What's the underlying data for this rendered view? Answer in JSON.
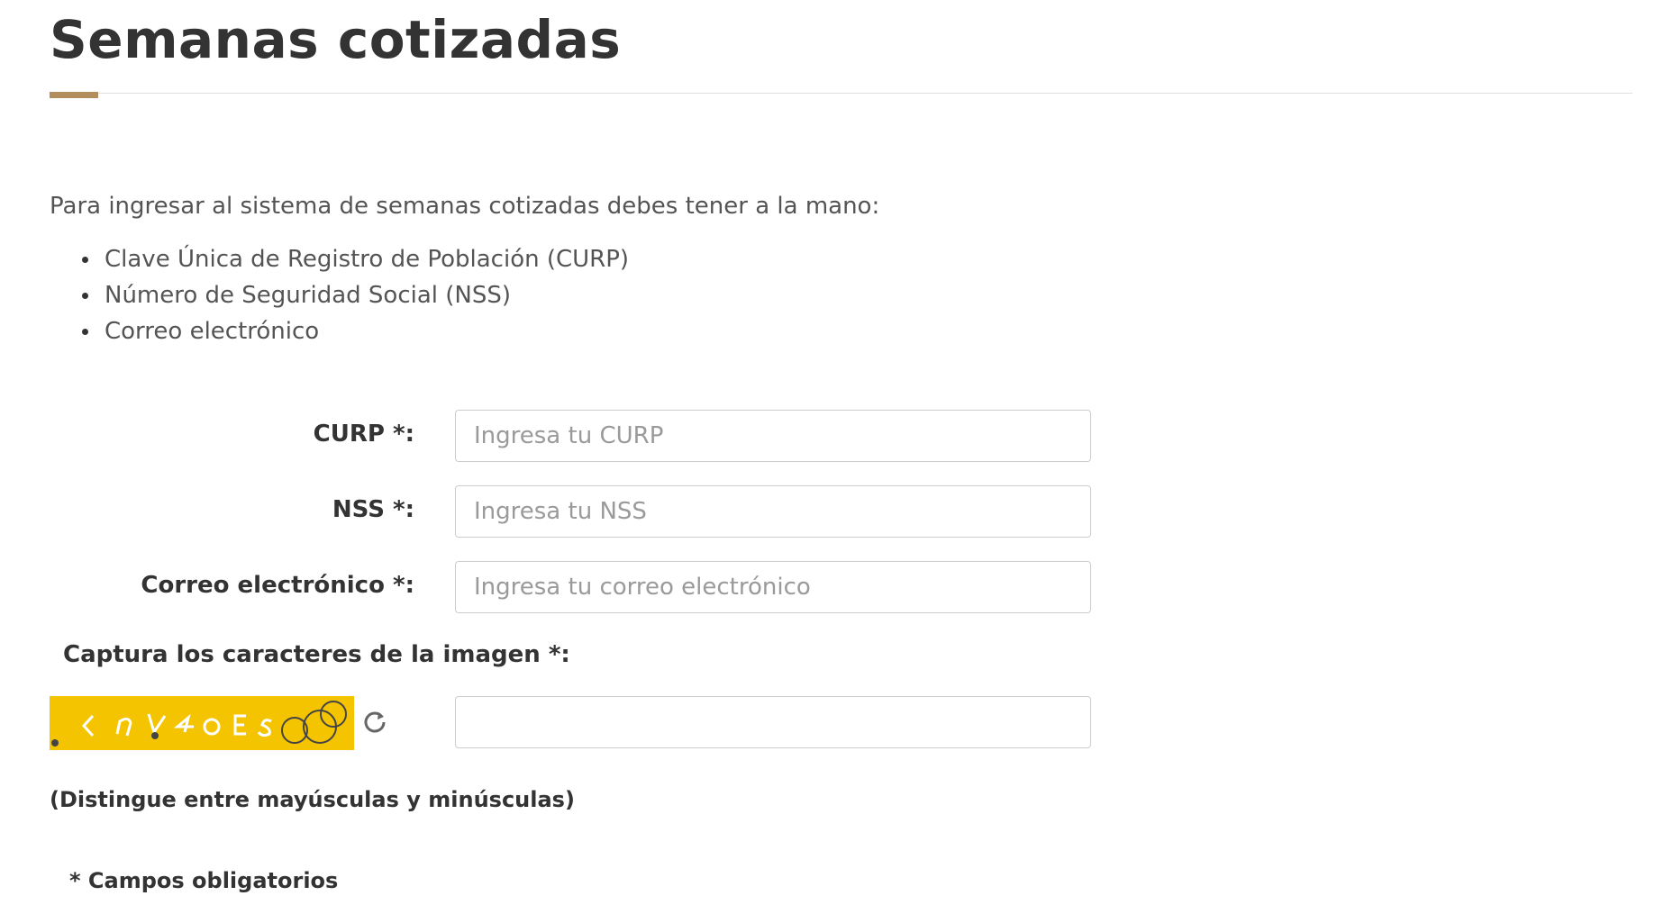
{
  "page": {
    "title": "Semanas cotizadas",
    "accent_color": "#b38e5d"
  },
  "intro": {
    "text": "Para ingresar al sistema de semanas cotizadas debes tener a la mano:",
    "requirements": [
      "Clave Única de Registro de Población (CURP)",
      "Número de Seguridad Social (NSS)",
      "Correo electrónico"
    ]
  },
  "form": {
    "curp": {
      "label": "CURP *:",
      "placeholder": "Ingresa tu CURP",
      "value": ""
    },
    "nss": {
      "label": "NSS *:",
      "placeholder": "Ingresa tu NSS",
      "value": ""
    },
    "email": {
      "label": "Correo electrónico *:",
      "placeholder": "Ingresa tu correo electrónico",
      "value": ""
    },
    "captcha": {
      "label": "Captura los caracteres de la imagen *:",
      "image_text": "<n Y 4 a E s",
      "image_background": "#f5c400",
      "refresh_icon": "refresh-icon",
      "value": ""
    },
    "case_note": "(Distingue entre mayúsculas y minúsculas)",
    "required_note": "* Campos obligatorios"
  }
}
